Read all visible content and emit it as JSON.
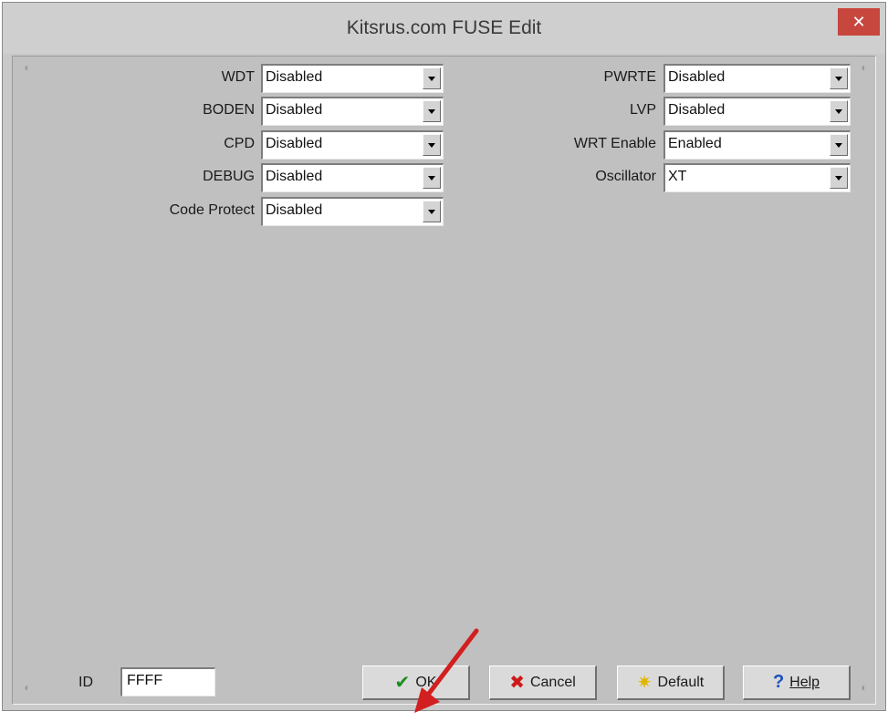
{
  "window": {
    "title": "Kitsrus.com FUSE Edit",
    "close_glyph": "✕"
  },
  "left_fields": [
    {
      "label": "WDT",
      "value": "Disabled"
    },
    {
      "label": "BODEN",
      "value": "Disabled"
    },
    {
      "label": "CPD",
      "value": "Disabled"
    },
    {
      "label": "DEBUG",
      "value": "Disabled"
    },
    {
      "label": "Code Protect",
      "value": "Disabled"
    }
  ],
  "right_fields": [
    {
      "label": "PWRTE",
      "value": "Disabled"
    },
    {
      "label": "LVP",
      "value": "Disabled"
    },
    {
      "label": "WRT Enable",
      "value": "Enabled"
    },
    {
      "label": "Oscillator",
      "value": "XT"
    }
  ],
  "id_field": {
    "label": "ID",
    "value": "FFFF"
  },
  "buttons": {
    "ok": {
      "label": "OK",
      "icon": "checkmark-icon",
      "glyph": "✔"
    },
    "cancel": {
      "label": "Cancel",
      "icon": "x-mark-icon",
      "glyph": "✖"
    },
    "default": {
      "label": "Default",
      "icon": "sparkle-icon",
      "glyph": "✷"
    },
    "help": {
      "label": "Help",
      "icon": "question-mark-icon",
      "glyph": "?"
    }
  },
  "colors": {
    "close_button": "#c7463d",
    "annotation_arrow": "#d21f1f"
  }
}
